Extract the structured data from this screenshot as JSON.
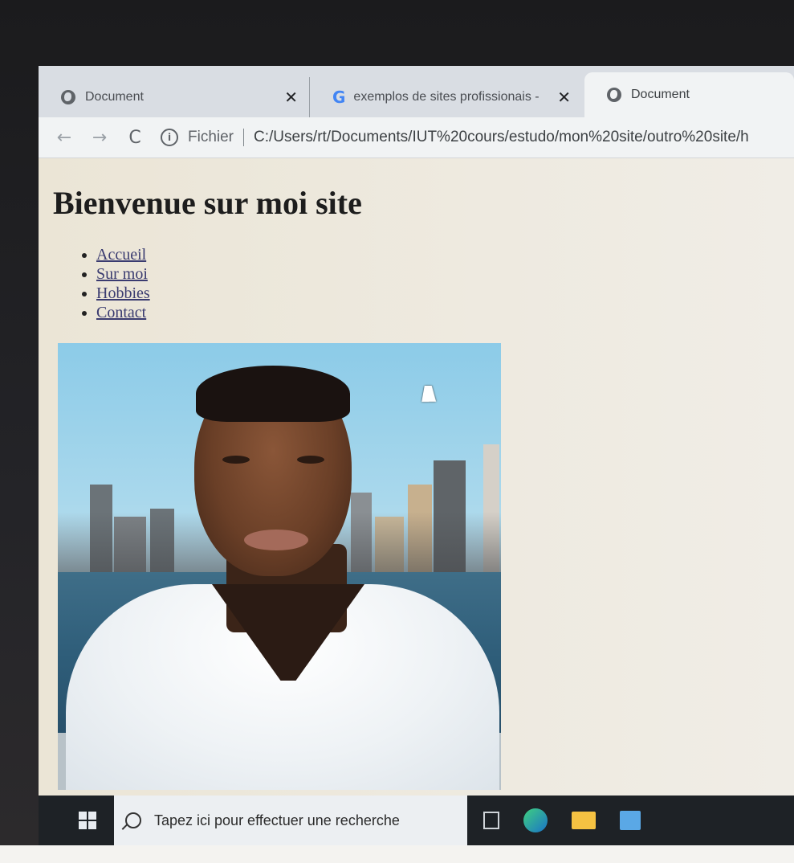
{
  "browser": {
    "tabs": [
      {
        "label": "Document",
        "icon": "globe-icon",
        "close": "✕"
      },
      {
        "label": "exemplos de sites profissionais -",
        "icon": "google-icon",
        "close": "✕"
      },
      {
        "label": "Document",
        "icon": "globe-icon",
        "active": true
      }
    ],
    "toolbar": {
      "back": "←",
      "forward": "→",
      "reload": "C",
      "info": "i",
      "scheme": "Fichier",
      "url": "C:/Users/rt/Documents/IUT%20cours/estudo/mon%20site/outro%20site/h"
    }
  },
  "page": {
    "title": "Bienvenue sur moi site",
    "nav": [
      {
        "label": "Accueil"
      },
      {
        "label": "Sur moi"
      },
      {
        "label": "Hobbies"
      },
      {
        "label": "Contact"
      }
    ]
  },
  "taskbar": {
    "search_placeholder": "Tapez ici pour effectuer une recherche"
  },
  "colors": {
    "page_bg": "#ece8dd",
    "link": "#3a3b70",
    "taskbar": "#1e2226"
  }
}
